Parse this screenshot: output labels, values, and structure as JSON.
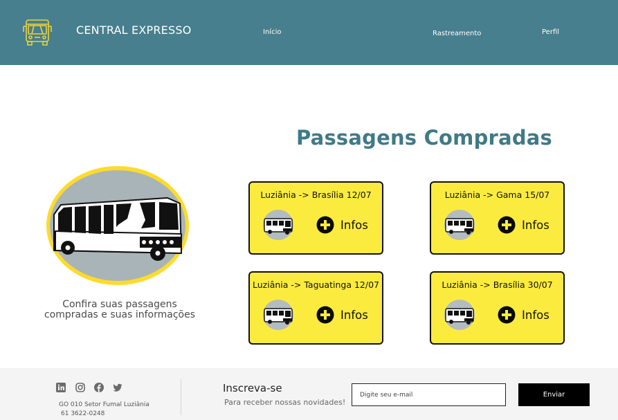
{
  "header": {
    "brand": "CENTRAL EXPRESSO",
    "logo_icon": "bus-outline-icon",
    "nav": {
      "inicio": "Início",
      "rastreamento": "Rastreamento",
      "perfil": "Perfil"
    }
  },
  "main": {
    "title": "Passagens Compradas",
    "illustration_icon": "bus-illustration-icon",
    "caption_line1": "Confira suas passagens",
    "caption_line2": "compradas e suas informações",
    "cards": [
      {
        "route": "Luziânia -> Brasília 12/07",
        "action": "Infos"
      },
      {
        "route": "Luziânia -> Gama 15/07",
        "action": "Infos"
      },
      {
        "route": "Luziânia -> Taguatinga 12/07",
        "action": "Infos"
      },
      {
        "route": "Luziânia -> Brasília 30/07",
        "action": "Infos"
      }
    ]
  },
  "footer": {
    "social_icons": [
      "linkedin-icon",
      "instagram-icon",
      "facebook-icon",
      "twitter-icon"
    ],
    "address": "GO 010 Setor Fumal Luziânia",
    "phone": "61 3622-0248",
    "subscribe_title": "Inscreva-se",
    "subscribe_sub": "Para receber nossas novidades!",
    "email_placeholder": "Digite seu e-mail",
    "email_value": "",
    "send_label": "Enviar"
  },
  "colors": {
    "header_bg": "#487f8e",
    "title": "#3f7a89",
    "card_bg": "#fceb3f",
    "logo_stroke": "#f1d233",
    "footer_bg": "#f4f4f4"
  }
}
